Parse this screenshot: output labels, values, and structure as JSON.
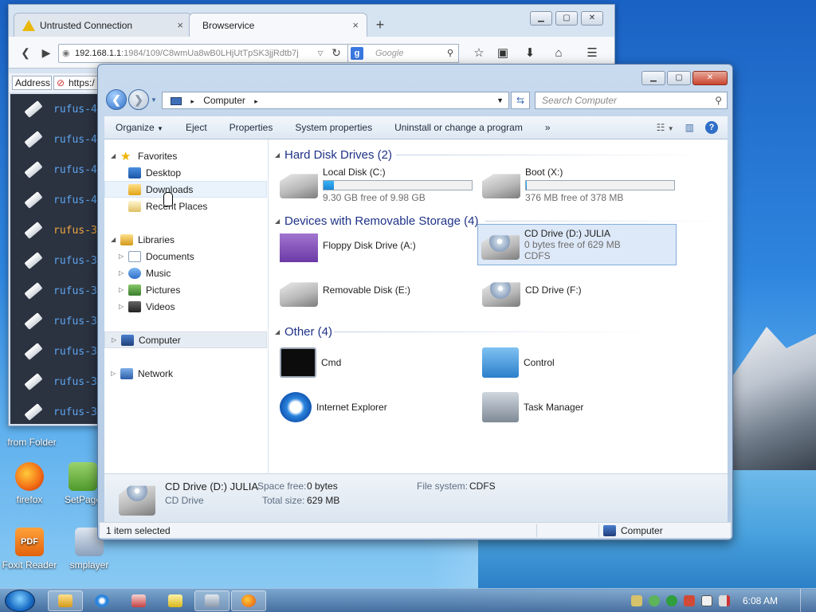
{
  "desktop": {
    "partial_label": "from Folder",
    "icons": [
      {
        "label": "firefox",
        "icon": "firefox-icon"
      },
      {
        "label": "SetPage",
        "icon": "setpage-icon"
      },
      {
        "label": "Foxit Reader",
        "icon": "foxit-reader-icon",
        "badge": "PDF"
      },
      {
        "label": "smplayer",
        "icon": "smplayer-icon"
      }
    ]
  },
  "browser": {
    "tabs": [
      {
        "title": "Untrusted Connection",
        "close": "×"
      },
      {
        "title": "Browservice",
        "close": "×"
      }
    ],
    "new_tab": "+",
    "url": "192.168.1.1",
    "url_rest": ":1984/109/C8wmUa8wB0LHjUtTpSK3jjRdtb7j",
    "search_placeholder": "Google",
    "search_engine_badge": "g",
    "inner_address_label": "Address",
    "inner_address_value": "https:/",
    "rufus_items": [
      {
        "text": "rufus-4",
        "color": "blue"
      },
      {
        "text": "rufus-4",
        "color": "blue"
      },
      {
        "text": "rufus-4",
        "color": "blue"
      },
      {
        "text": "rufus-4",
        "color": "blue"
      },
      {
        "text": "rufus-3",
        "color": "orange"
      },
      {
        "text": "rufus-3",
        "color": "blue"
      },
      {
        "text": "rufus-3",
        "color": "blue"
      },
      {
        "text": "rufus-3",
        "color": "blue"
      },
      {
        "text": "rufus-3",
        "color": "blue"
      },
      {
        "text": "rufus-3",
        "color": "blue"
      },
      {
        "text": "rufus-3",
        "color": "blue"
      }
    ]
  },
  "explorer": {
    "breadcrumb": "Computer",
    "search_placeholder": "Search Computer",
    "toolbar": {
      "organize": "Organize",
      "eject": "Eject",
      "properties": "Properties",
      "system_properties": "System properties",
      "uninstall": "Uninstall or change a program",
      "more": "»"
    },
    "nav": {
      "favorites": "Favorites",
      "desktop": "Desktop",
      "downloads": "Downloads",
      "recent": "Recent Places",
      "libraries": "Libraries",
      "documents": "Documents",
      "music": "Music",
      "pictures": "Pictures",
      "videos": "Videos",
      "computer": "Computer",
      "network": "Network"
    },
    "groups": {
      "hdd": "Hard Disk Drives (2)",
      "removable": "Devices with Removable Storage (4)",
      "other": "Other (4)"
    },
    "drives": {
      "c": {
        "name": "Local Disk (C:)",
        "free": "9.30 GB free of 9.98 GB",
        "used_fraction": 0.07
      },
      "x": {
        "name": "Boot (X:)",
        "free": "376 MB free of 378 MB",
        "used_fraction": 0.005
      },
      "a": {
        "name": "Floppy Disk Drive (A:)"
      },
      "d": {
        "name": "CD Drive (D:) JULIA",
        "free": "0 bytes free of 629 MB",
        "fs": "CDFS"
      },
      "e": {
        "name": "Removable Disk (E:)"
      },
      "f": {
        "name": "CD Drive (F:)"
      }
    },
    "other_items": {
      "cmd": "Cmd",
      "control": "Control",
      "ie": "Internet Explorer",
      "taskmgr": "Task Manager"
    },
    "details": {
      "name": "CD Drive (D:) JULIA",
      "type": "CD Drive",
      "space_free_label": "Space free:",
      "space_free": "0 bytes",
      "total_size_label": "Total size:",
      "total_size": "629 MB",
      "fs_label": "File system:",
      "fs": "CDFS"
    },
    "status": {
      "selection": "1 item selected",
      "location": "Computer"
    }
  },
  "taskbar": {
    "clock": "6:08 AM"
  }
}
